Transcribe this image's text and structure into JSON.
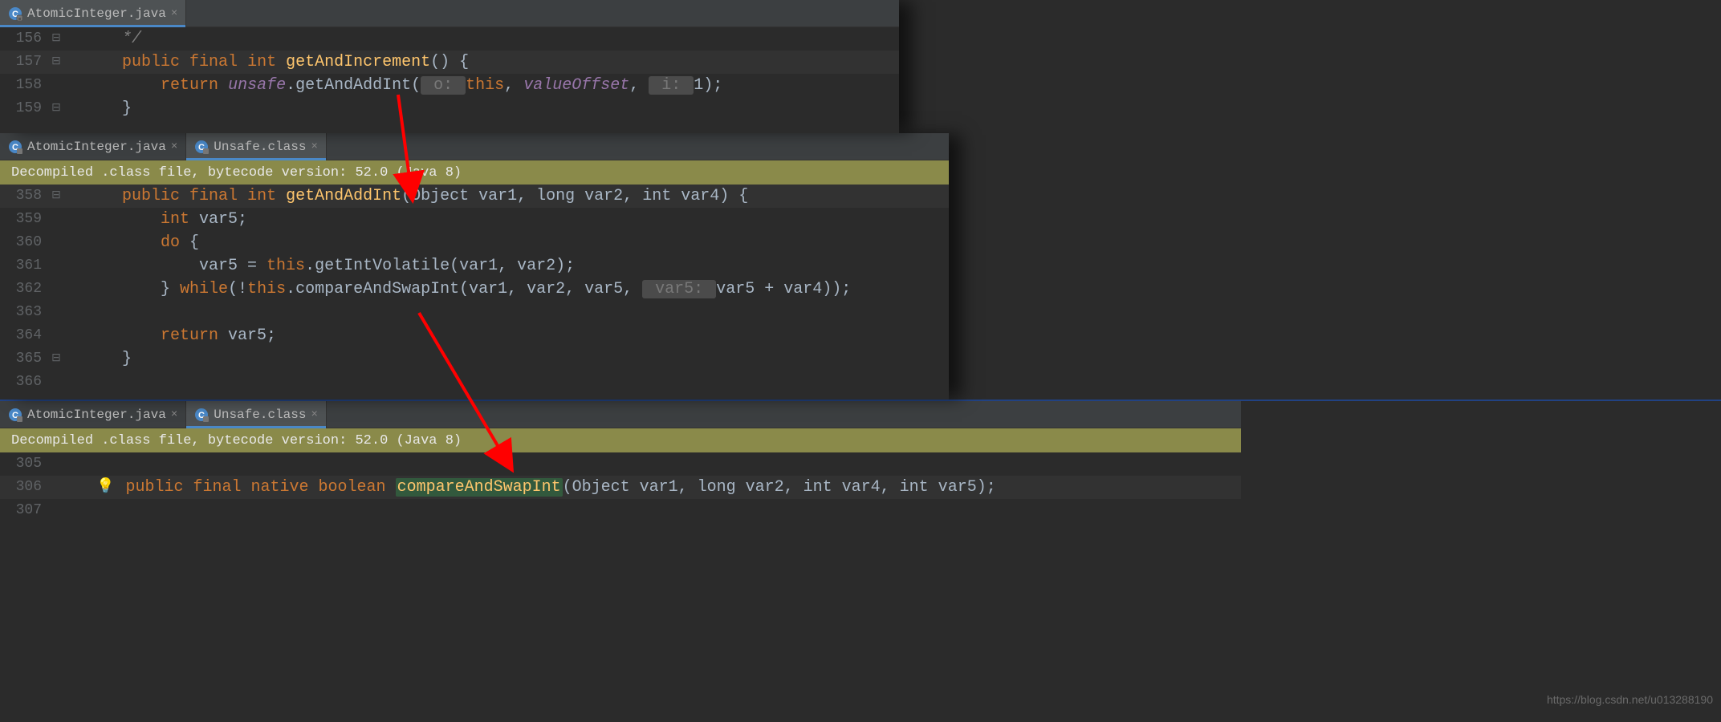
{
  "panel1": {
    "tabs": [
      {
        "label": "AtomicInteger.java",
        "active": true
      }
    ],
    "lines": {
      "l156": "156",
      "l157": "157",
      "l158": "158",
      "l159": "159"
    },
    "code": {
      "com_end": "*/",
      "kw_public": "public",
      "kw_final": "final",
      "kw_int": "int",
      "meth_getAndIncrement": "getAndIncrement",
      "paren_open_brace": "() {",
      "kw_return": "return",
      "unsafe": "unsafe",
      "dot": ".",
      "getAndAddInt": "getAndAddInt",
      "lparen": "(",
      "hint_o": " o: ",
      "kw_this": "this",
      "comma": ", ",
      "valueOffset": "valueOffset",
      "hint_i": " i: ",
      "one": "1",
      "rparen_semi": ");",
      "brace_close": "}"
    }
  },
  "panel2": {
    "tabs": [
      {
        "label": "AtomicInteger.java",
        "active": false
      },
      {
        "label": "Unsafe.class",
        "active": true
      }
    ],
    "notification": "Decompiled .class file, bytecode version: 52.0 (Java 8)",
    "lines": {
      "l358": "358",
      "l359": "359",
      "l360": "360",
      "l361": "361",
      "l362": "362",
      "l363": "363",
      "l364": "364",
      "l365": "365",
      "l366": "366"
    },
    "code": {
      "kw_public": "public",
      "kw_final": "final",
      "kw_int": "int",
      "meth_getAndAddInt": "getAndAddInt",
      "sig": "(Object var1, long var2, int var4) {",
      "int_var5": "int",
      "var5_decl": " var5;",
      "kw_do": "do",
      "do_brace": " {",
      "assign_line": "var5 = ",
      "kw_this1": "this",
      "getIntVolatile": ".getIntVolatile(var1, var2);",
      "close_do": "} ",
      "kw_while": "while",
      "while_open": "(!",
      "kw_this2": "this",
      "compareAndSwapInt": ".compareAndSwapInt(var1, var2, var5, ",
      "hint_var5": " var5: ",
      "while_end": "var5 + var4));",
      "kw_return": "return",
      "ret_var5": " var5;",
      "brace_close": "}"
    }
  },
  "panel3": {
    "tabs": [
      {
        "label": "AtomicInteger.java",
        "active": false
      },
      {
        "label": "Unsafe.class",
        "active": true
      }
    ],
    "notification": "Decompiled .class file, bytecode version: 52.0 (Java 8)",
    "lines": {
      "l305": "305",
      "l306": "306",
      "l307": "307"
    },
    "code": {
      "kw_public": "public",
      "kw_final": "final",
      "kw_native": "native",
      "kw_boolean": "boolean",
      "meth_compareAndSwapInt": "compareAndSwapInt",
      "sig": "(Object var1, long var2, int var4, int var5);"
    }
  },
  "watermark": "https://blog.csdn.net/u013288190"
}
